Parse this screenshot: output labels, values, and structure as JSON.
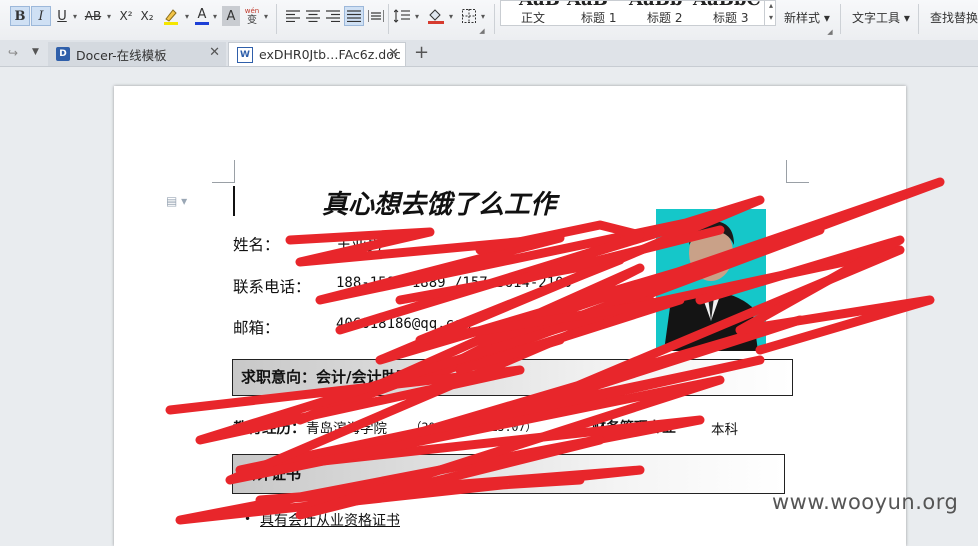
{
  "toolbar": {
    "bold": "B",
    "italic": "I",
    "underline": "U",
    "strike": "AB",
    "superscript": "X²",
    "subscript": "X₂",
    "font_color": "A",
    "char_shade": "A",
    "phonetic_top": "wén",
    "phonetic_bottom": "变",
    "styles": [
      {
        "label": "正文",
        "preview": "AaB"
      },
      {
        "label": "标题 1",
        "preview": "AaB"
      },
      {
        "label": "标题 2",
        "preview": "AaBb"
      },
      {
        "label": "标题 3",
        "preview": "AaBbC"
      }
    ],
    "new_style": "新样式",
    "text_tools": "文字工具",
    "find_replace": "查找替换"
  },
  "tabs": [
    {
      "label": "Docer-在线模板",
      "icon": "docer-icon"
    },
    {
      "label": "exDHR0Jtb…FAc6z.doc",
      "icon": "doc-icon"
    }
  ],
  "document": {
    "title": "真心想去饿了么工作",
    "fields": [
      {
        "label": "姓名：",
        "value": "王亚男"
      },
      {
        "label": "联系电话：",
        "value": "188-1584-1889 /157-3614-2100"
      },
      {
        "label": "邮箱：",
        "value": "406618186@qq.com"
      }
    ],
    "objective": "求职意向：会计/会计助理/出纳",
    "education_label": "教育经历：",
    "education_school": "青岛滨海学院",
    "education_dates": "（2011.09-2015.07）",
    "education_major": "财务管理专业",
    "education_degree": "本科",
    "certificate_header": "会计证书",
    "certificate_item": "具有会计从业资格证书"
  },
  "watermark": "www.wooyun.org",
  "colors": {
    "scribble": "#e8262b",
    "photo_bg": "#15c7c9",
    "tab_accent": "#2f5faa"
  }
}
